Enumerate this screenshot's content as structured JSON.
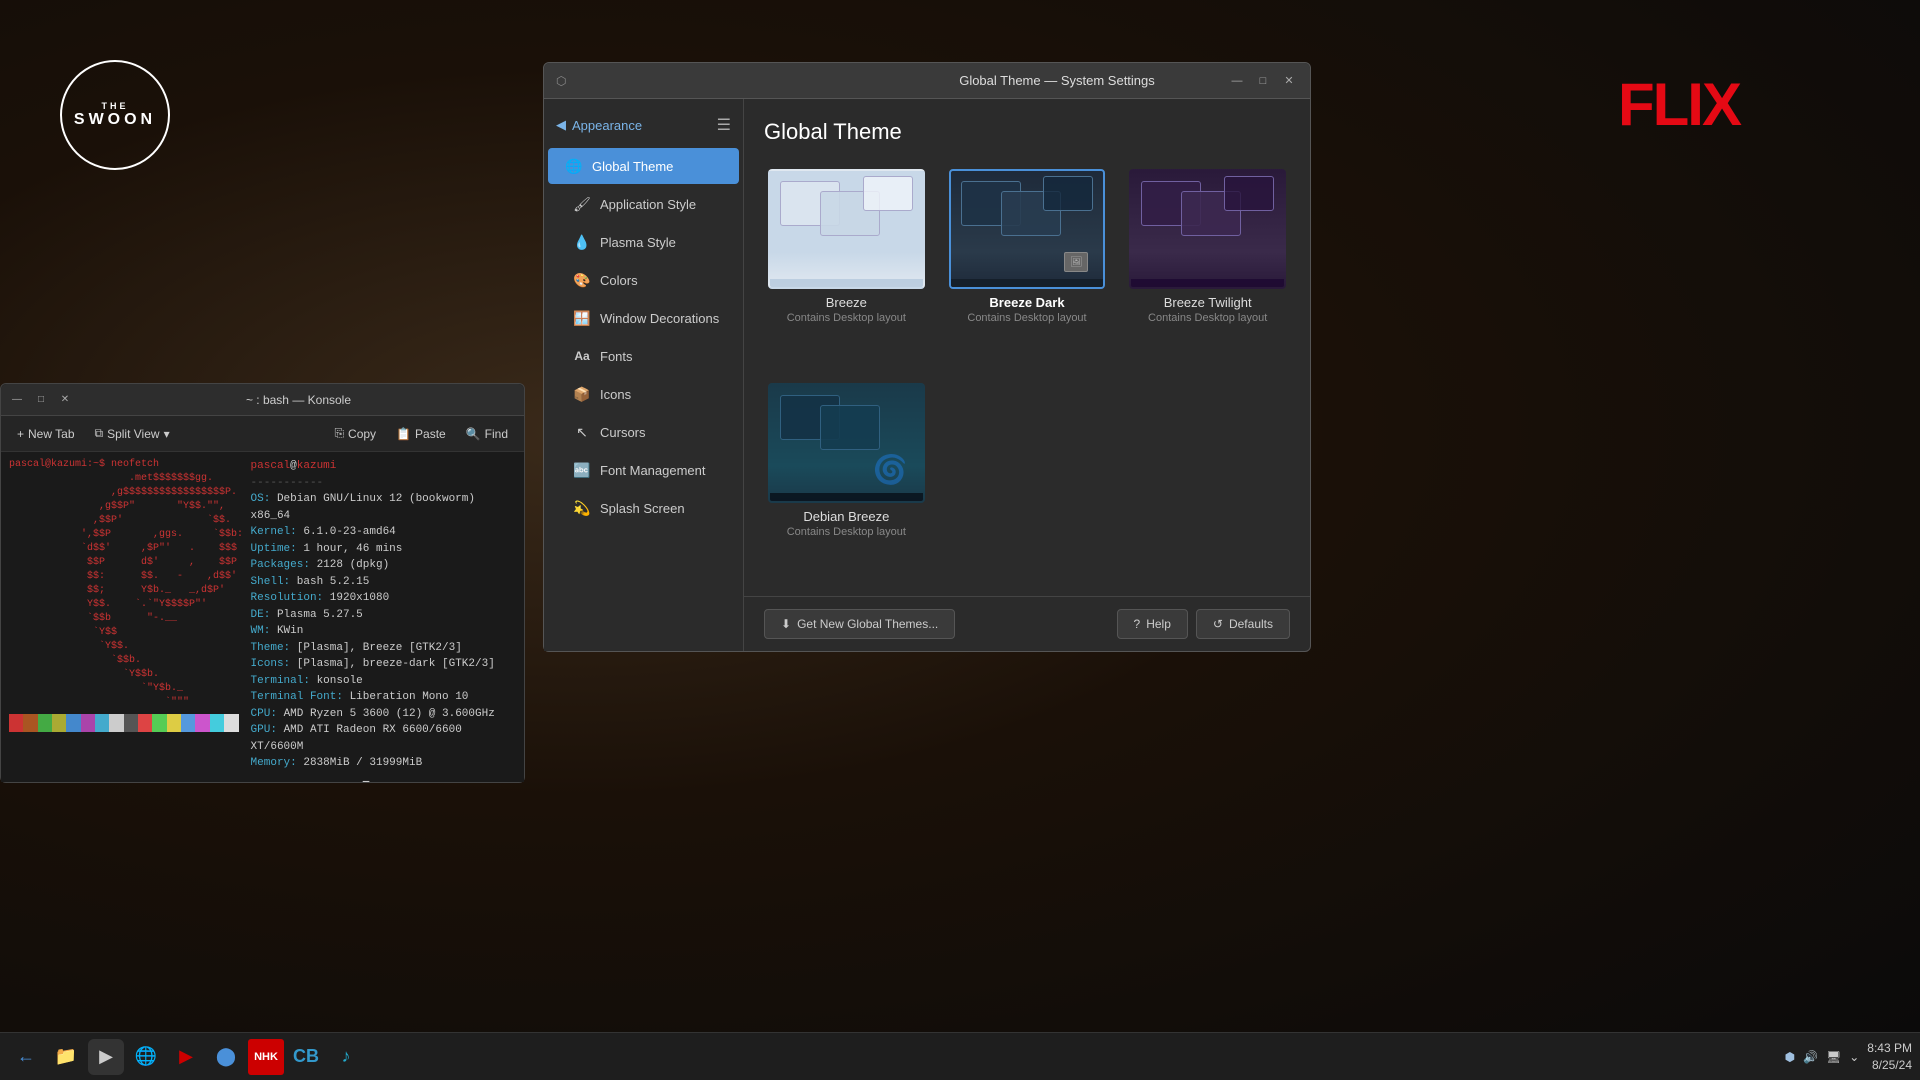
{
  "desktop": {
    "logo": {
      "the": "THE",
      "swoon": "SWOON"
    },
    "netflix": "FLIX"
  },
  "terminal": {
    "title": "~ : bash — Konsole",
    "min_btn": "—",
    "max_btn": "□",
    "close_btn": "✕",
    "toolbar": {
      "new_tab": "New Tab",
      "split_view": "Split View",
      "split_arrow": "▾",
      "copy": "Copy",
      "paste": "Paste",
      "find": "Find"
    },
    "content_lines": [
      "pascal@kazumi:~$ neofetch",
      "                    .met$$$$$$$gg.",
      "                 ,g$$$$$$$$$$$$$$$$$P.",
      "               ,g$$P\"\"       \"\"\"Y$$.\"\",",
      "              ,$$P'              `$$.",
      "            ',$$P       ,ggs.     `$$b:",
      "            `d$$'     ,$P\"'   .    $$$",
      "             $$P      d$'     ,    $$P",
      "             $$:      $$.   -    ,d$$'",
      "             $$;      Y$b._   _,d$P'",
      "             Y$$.    `.`\"Y$$$$P\"'",
      "             `$$b      \"-.__",
      "              `Y$$",
      "               `Y$$.",
      "                 `$$b.",
      "                   `Y$$b.",
      "                      `\"Y$b._",
      "                          `\"\"\""
    ],
    "sysinfo": {
      "os_label": "OS:",
      "os_value": "Debian GNU/Linux 12 (bookworm) x86_64",
      "kernel_label": "Kernel:",
      "kernel_value": "6.1.0-23-amd64",
      "uptime_label": "Uptime:",
      "uptime_value": "1 hour, 46 mins",
      "packages_label": "Packages:",
      "packages_value": "2128 (dpkg)",
      "shell_label": "Shell:",
      "shell_value": "bash 5.2.15",
      "resolution_label": "Resolution:",
      "resolution_value": "1920x1080",
      "de_label": "DE:",
      "de_value": "Plasma 5.27.5",
      "wm_label": "WM:",
      "wm_value": "KWin",
      "theme_label": "Theme:",
      "theme_value": "[Plasma], Breeze [GTK2/3]",
      "icons_label": "Icons:",
      "icons_value": "[Plasma], breeze-dark [GTK2/3]",
      "terminal_label": "Terminal:",
      "terminal_value": "konsole",
      "font_label": "Terminal Font:",
      "font_value": "Liberation Mono 10",
      "cpu_label": "CPU:",
      "cpu_value": "AMD Ryzen 5 3600 (12) @ 3.600GHz",
      "gpu_label": "GPU:",
      "gpu_value": "AMD ATI Radeon RX 6600/6600 XT/6600M",
      "memory_label": "Memory:",
      "memory_value": "2838MiB / 31999MiB"
    },
    "colors": [
      "#cc3333",
      "#aa5522",
      "#44aa44",
      "#aaaa33",
      "#4488cc",
      "#aa44aa",
      "#44aacc",
      "#cccccc",
      "#555555",
      "#dd4444",
      "#55cc55",
      "#ddcc44",
      "#5599dd",
      "#cc55cc",
      "#44ccdd",
      "#dddddd"
    ],
    "prompt": "pascal@kazumi:~$ "
  },
  "settings": {
    "title": "Global Theme — System Settings",
    "min_btn": "—",
    "restore_btn": "□",
    "close_btn": "✕",
    "sidebar": {
      "back_label": "Appearance",
      "menu_icon": "☰",
      "items": [
        {
          "id": "global-theme",
          "label": "Global Theme",
          "icon": "🌐",
          "active": true
        },
        {
          "id": "application-style",
          "label": "Application Style",
          "icon": "🖌"
        },
        {
          "id": "plasma-style",
          "label": "Plasma Style",
          "icon": "💧"
        },
        {
          "id": "colors",
          "label": "Colors",
          "icon": "🎨"
        },
        {
          "id": "window-decorations",
          "label": "Window Decorations",
          "icon": "🪟"
        },
        {
          "id": "fonts",
          "label": "Fonts",
          "icon": "Aa"
        },
        {
          "id": "icons",
          "label": "Icons",
          "icon": "📦"
        },
        {
          "id": "cursors",
          "label": "Cursors",
          "icon": "↖"
        },
        {
          "id": "font-management",
          "label": "Font Management",
          "icon": "🔤"
        },
        {
          "id": "splash-screen",
          "label": "Splash Screen",
          "icon": "💫"
        }
      ]
    },
    "main": {
      "title": "Global Theme",
      "themes": [
        {
          "id": "breeze",
          "name": "Breeze",
          "description": "Contains Desktop layout",
          "selected": false,
          "style": "light"
        },
        {
          "id": "breeze-dark",
          "name": "Breeze Dark",
          "description": "Contains Desktop layout",
          "selected": true,
          "style": "dark"
        },
        {
          "id": "breeze-twilight",
          "name": "Breeze Twilight",
          "description": "Contains Desktop layout",
          "selected": false,
          "style": "twilight"
        },
        {
          "id": "debian-breeze",
          "name": "Debian Breeze",
          "description": "Contains Desktop layout",
          "selected": false,
          "style": "debian"
        }
      ],
      "get_themes_label": "Get New Global Themes...",
      "help_label": "Help",
      "defaults_label": "Defaults"
    }
  },
  "taskbar": {
    "icons": [
      {
        "id": "back",
        "symbol": "←",
        "color": "#4a90d9"
      },
      {
        "id": "files",
        "symbol": "📁",
        "color": "#f0a030"
      },
      {
        "id": "konsole",
        "symbol": "▶",
        "color": "#555"
      },
      {
        "id": "firefox",
        "symbol": "🌐",
        "color": "#4a90d9"
      },
      {
        "id": "youtube",
        "symbol": "▶",
        "color": "#cc0000"
      },
      {
        "id": "chrome",
        "symbol": "●",
        "color": "#4a90d9"
      },
      {
        "id": "nhk",
        "symbol": "N",
        "color": "#fff"
      },
      {
        "id": "cbw",
        "symbol": "C",
        "color": "#3399cc"
      },
      {
        "id": "music",
        "symbol": "♪",
        "color": "#22aacc"
      }
    ],
    "right": {
      "steam_icon": "🎮",
      "speaker_icon": "🔊",
      "monitor_icon": "🖥",
      "battery_icon": "⌄",
      "time": "8:43 PM",
      "date": "8/25/24"
    }
  }
}
